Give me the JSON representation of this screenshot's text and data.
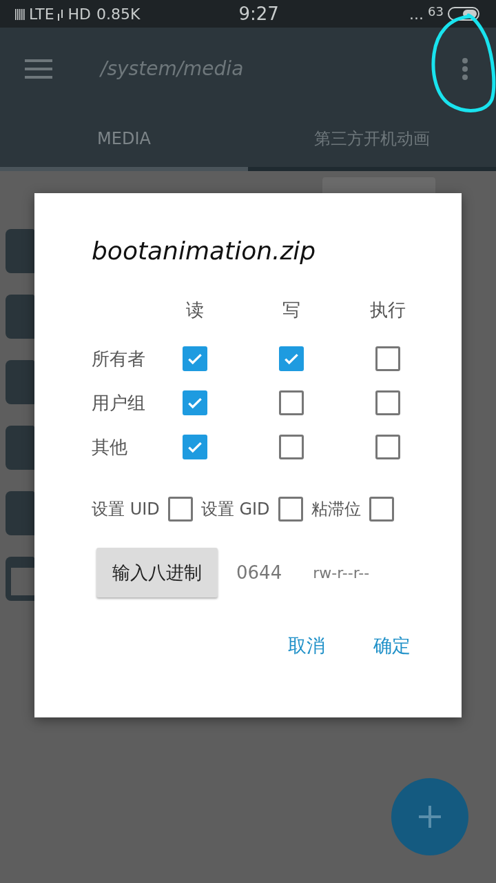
{
  "status_bar": {
    "network": "LTE",
    "hd": "HD",
    "speed": "0.85K",
    "time": "9:27",
    "more": "...",
    "battery": "63"
  },
  "toolbar": {
    "path": "/system/media"
  },
  "tabs": [
    {
      "label": "MEDIA",
      "selected": true
    },
    {
      "label": "第三方开机动画",
      "selected": false
    }
  ],
  "files": [
    {
      "kind": "folder"
    },
    {
      "kind": "folder"
    },
    {
      "kind": "folder"
    },
    {
      "kind": "folder"
    },
    {
      "kind": "folder"
    },
    {
      "kind": "file"
    }
  ],
  "dialog": {
    "title": "bootanimation.zip",
    "columns": [
      "读",
      "写",
      "执行"
    ],
    "rows": [
      {
        "label": "所有者",
        "checks": [
          {
            "checked": true
          },
          {
            "checked": true
          },
          {
            "checked": false
          }
        ]
      },
      {
        "label": "用户组",
        "checks": [
          {
            "checked": true
          },
          {
            "checked": false
          },
          {
            "checked": false
          }
        ]
      },
      {
        "label": "其他",
        "checks": [
          {
            "checked": true
          },
          {
            "checked": false
          },
          {
            "checked": false
          }
        ]
      }
    ],
    "special": [
      {
        "label": "设置 UID",
        "checked": false
      },
      {
        "label": "设置 GID",
        "checked": false
      },
      {
        "label": "粘滞位",
        "checked": false
      }
    ],
    "octal_button": "输入八进制",
    "octal": "0644",
    "symbolic": "rw-r--r--",
    "buttons": [
      "取消",
      "确定"
    ]
  }
}
